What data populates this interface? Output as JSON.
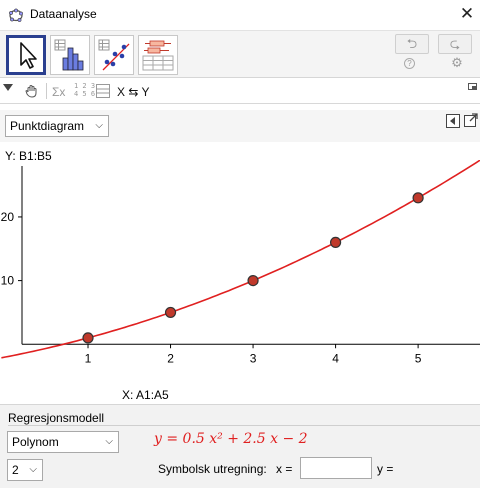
{
  "window": {
    "title": "Dataanalyse",
    "close_glyph": "✕"
  },
  "modes": [
    {
      "name": "select-mode",
      "icon": "cursor-icon",
      "active": true
    },
    {
      "name": "one-variable-mode",
      "icon": "histogram-icon"
    },
    {
      "name": "two-variable-mode",
      "icon": "scatterplot-icon"
    },
    {
      "name": "multi-variable-mode",
      "icon": "boxplot-icon"
    }
  ],
  "history": {
    "undo_glyph": "⮌",
    "redo_glyph": "⮎",
    "help_glyph": "?",
    "settings_glyph": "⚙"
  },
  "toolbar2": {
    "sigma": "Σx",
    "digits_top": "1 2 3",
    "digits_bottom": "4 5 6",
    "swap_label": "X ⇆ Y"
  },
  "plot": {
    "type_label": "Punktdiagram",
    "y_source": "Y:  B1:B5",
    "x_source": "X:  A1:A5"
  },
  "chart_data": {
    "type": "scatter",
    "points": [
      {
        "x": 1,
        "y": 1
      },
      {
        "x": 2,
        "y": 5
      },
      {
        "x": 3,
        "y": 10
      },
      {
        "x": 4,
        "y": 16
      },
      {
        "x": 5,
        "y": 23
      }
    ],
    "fit": {
      "kind": "polynomial",
      "degree": 2,
      "a": 0.5,
      "b": 2.5,
      "c": -2,
      "color": "#e02020"
    },
    "x_ticks": [
      "1",
      "2",
      "3",
      "4",
      "5"
    ],
    "y_ticks": [
      "10",
      "20"
    ],
    "xlim": [
      0.2,
      5.75
    ],
    "ylim": [
      -2,
      28
    ],
    "point_color": "#c0392b"
  },
  "regression": {
    "section_title": "Regresjonsmodell",
    "model_label": "Polynom",
    "degree_label": "2",
    "equation": "y = 0.5 x² + 2.5 x − 2",
    "symbolic_label": "Symbolsk utregning:",
    "x_label": "x =",
    "x_value": "",
    "y_label": "y ="
  }
}
